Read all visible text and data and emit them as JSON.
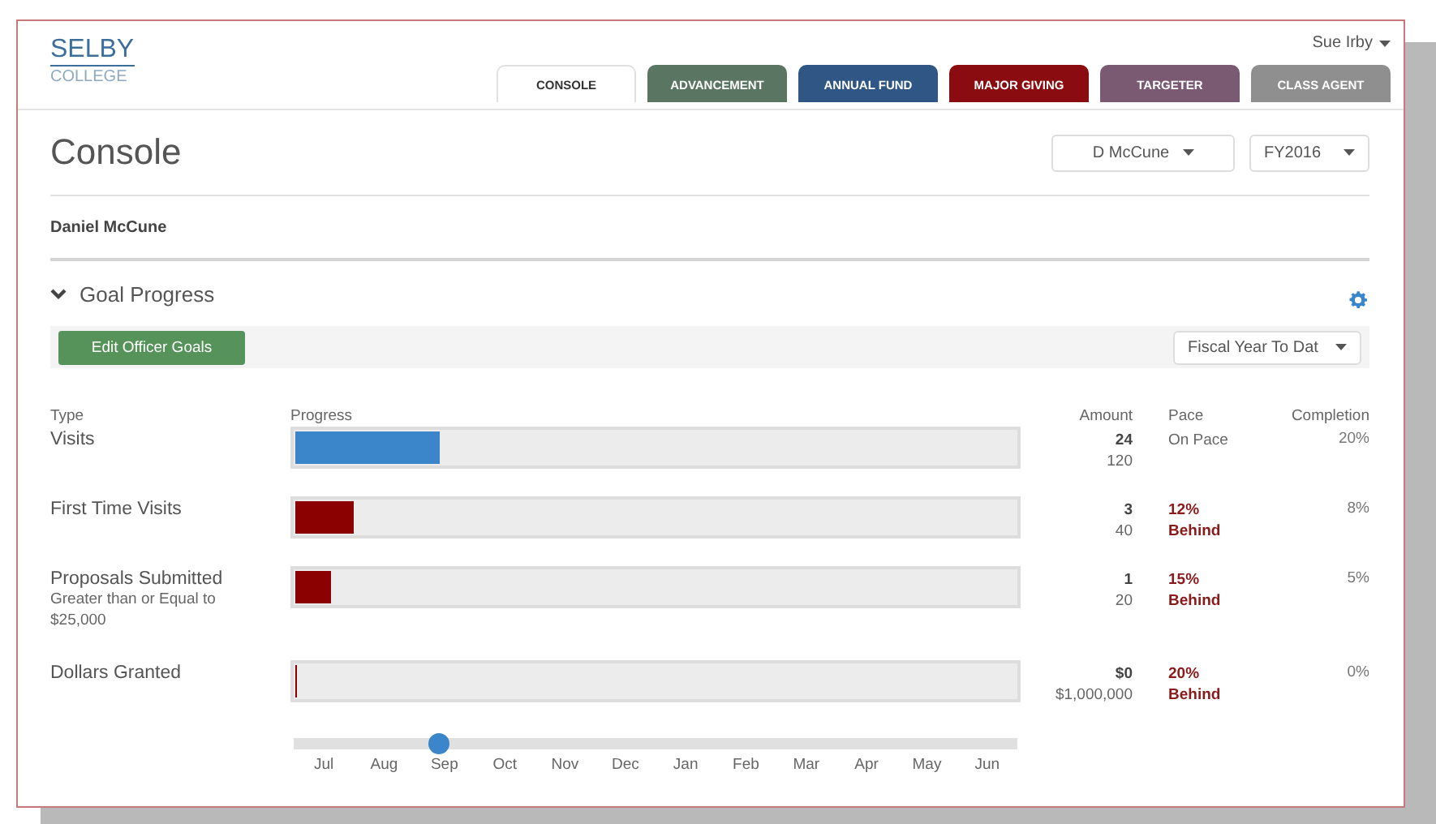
{
  "logo": {
    "name": "SELBY",
    "sub": "COLLEGE"
  },
  "user_menu": "Sue Irby",
  "tabs": [
    {
      "label": "CONSOLE",
      "selected": true,
      "color": "#ffffff"
    },
    {
      "label": "ADVANCEMENT",
      "selected": false,
      "color": "#5a7561"
    },
    {
      "label": "ANNUAL FUND",
      "selected": false,
      "color": "#2f5684"
    },
    {
      "label": "MAJOR GIVING",
      "selected": false,
      "color": "#8b0c10"
    },
    {
      "label": "TARGETER",
      "selected": false,
      "color": "#7a5a72"
    },
    {
      "label": "CLASS AGENT",
      "selected": false,
      "color": "#8f8f8f"
    }
  ],
  "page_title": "Console",
  "officer_select": "D McCune",
  "year_select": "FY2016",
  "officer_name": "Daniel McCune",
  "section": {
    "title": "Goal Progress",
    "expanded": true
  },
  "edit_button": "Edit Officer Goals",
  "period_select": "Fiscal Year To Dat",
  "columns": [
    "Type",
    "Progress",
    "Amount",
    "Pace",
    "Completion"
  ],
  "rows": [
    {
      "type": "Visits",
      "level": 0.2,
      "behind": false,
      "amount": "24",
      "goal": "120",
      "pace": [
        "On Pace"
      ],
      "completion": "20%"
    },
    {
      "type": "First Time Visits",
      "level": 0.08,
      "behind": true,
      "amount": "3",
      "goal": "40",
      "pace": [
        "12%",
        "Behind"
      ],
      "completion": "8%"
    },
    {
      "type": "Proposals Submitted",
      "note": [
        "Greater than or Equal to",
        "$25,000"
      ],
      "level": 0.05,
      "behind": true,
      "amount": "1",
      "goal": "20",
      "pace": [
        "15%",
        "Behind"
      ],
      "completion": "5%"
    },
    {
      "type": "Dollars Granted",
      "level": 0,
      "behind": true,
      "amount": "$0",
      "goal": "$1,000,000",
      "pace": [
        "20%",
        "Behind"
      ],
      "completion": "0%"
    }
  ],
  "timeline": {
    "level": 0.2,
    "months": [
      "Jul",
      "Aug",
      "Sep",
      "Oct",
      "Nov",
      "Dec",
      "Jan",
      "Feb",
      "Mar",
      "Apr",
      "May",
      "Jun"
    ]
  }
}
